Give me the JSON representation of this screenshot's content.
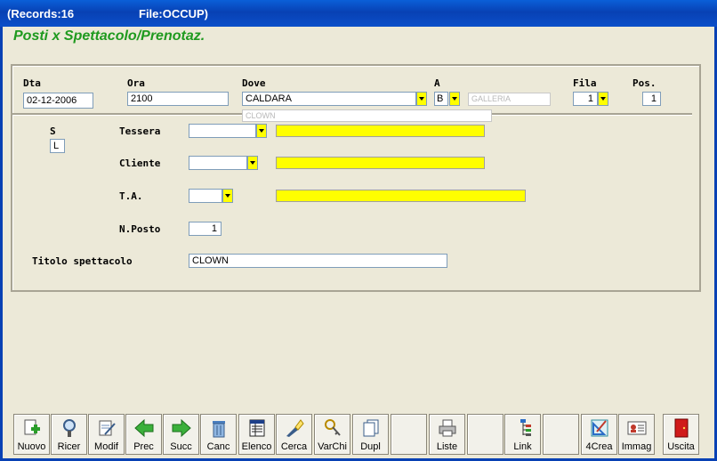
{
  "window": {
    "records_label": "(Records:16",
    "file_label": "File:OCCUP)"
  },
  "form_title": "Posti x Spettacolo/Prenotaz.",
  "header_fields": {
    "dta": {
      "label": "Dta",
      "value": "02-12-2006"
    },
    "ora": {
      "label": "Ora",
      "value": "2100"
    },
    "dove": {
      "label": "Dove",
      "value": "CALDARA",
      "sub": "CLOWN"
    },
    "a": {
      "label": "A",
      "value": "B",
      "desc": "GALLERIA"
    },
    "fila": {
      "label": "Fila",
      "value": "1"
    },
    "pos": {
      "label": "Pos.",
      "value": "1"
    }
  },
  "detail_fields": {
    "s": {
      "label": "S",
      "value": "L"
    },
    "tessera": {
      "label": "Tessera",
      "value": "",
      "desc": ""
    },
    "cliente": {
      "label": "Cliente",
      "value": "",
      "desc": ""
    },
    "ta": {
      "label": "T.A.",
      "value": "",
      "desc": ""
    },
    "nposto": {
      "label": "N.Posto",
      "value": "1"
    },
    "titolo": {
      "label": "Titolo spettacolo",
      "value": "CLOWN"
    }
  },
  "colors": {
    "accent_title": "#1f9a1f",
    "lookup_bg": "#ffff00",
    "titlebar": "#0841b4"
  },
  "toolbar": [
    {
      "label": "Nuovo",
      "icon": "new-document-icon"
    },
    {
      "label": "Ricer",
      "icon": "magnifier-icon"
    },
    {
      "label": "Modif",
      "icon": "edit-document-icon"
    },
    {
      "label": "Prec",
      "icon": "arrow-left-icon"
    },
    {
      "label": "Succ",
      "icon": "arrow-right-icon"
    },
    {
      "label": "Canc",
      "icon": "trash-icon"
    },
    {
      "label": "Elenco",
      "icon": "list-icon"
    },
    {
      "label": "Cerca",
      "icon": "flashlight-icon"
    },
    {
      "label": "VarChi",
      "icon": "keys-icon"
    },
    {
      "label": "Dupl",
      "icon": "duplicate-icon"
    },
    {
      "label": "",
      "icon": ""
    },
    {
      "label": "Liste",
      "icon": "printer-icon"
    },
    {
      "label": "",
      "icon": ""
    },
    {
      "label": "Link",
      "icon": "tree-icon"
    },
    {
      "label": "",
      "icon": ""
    },
    {
      "label": "4Crea",
      "icon": "drafting-icon"
    },
    {
      "label": "Immag",
      "icon": "id-card-icon"
    },
    {
      "label": "",
      "icon": ""
    },
    {
      "label": "Uscita",
      "icon": "exit-door-icon"
    }
  ]
}
